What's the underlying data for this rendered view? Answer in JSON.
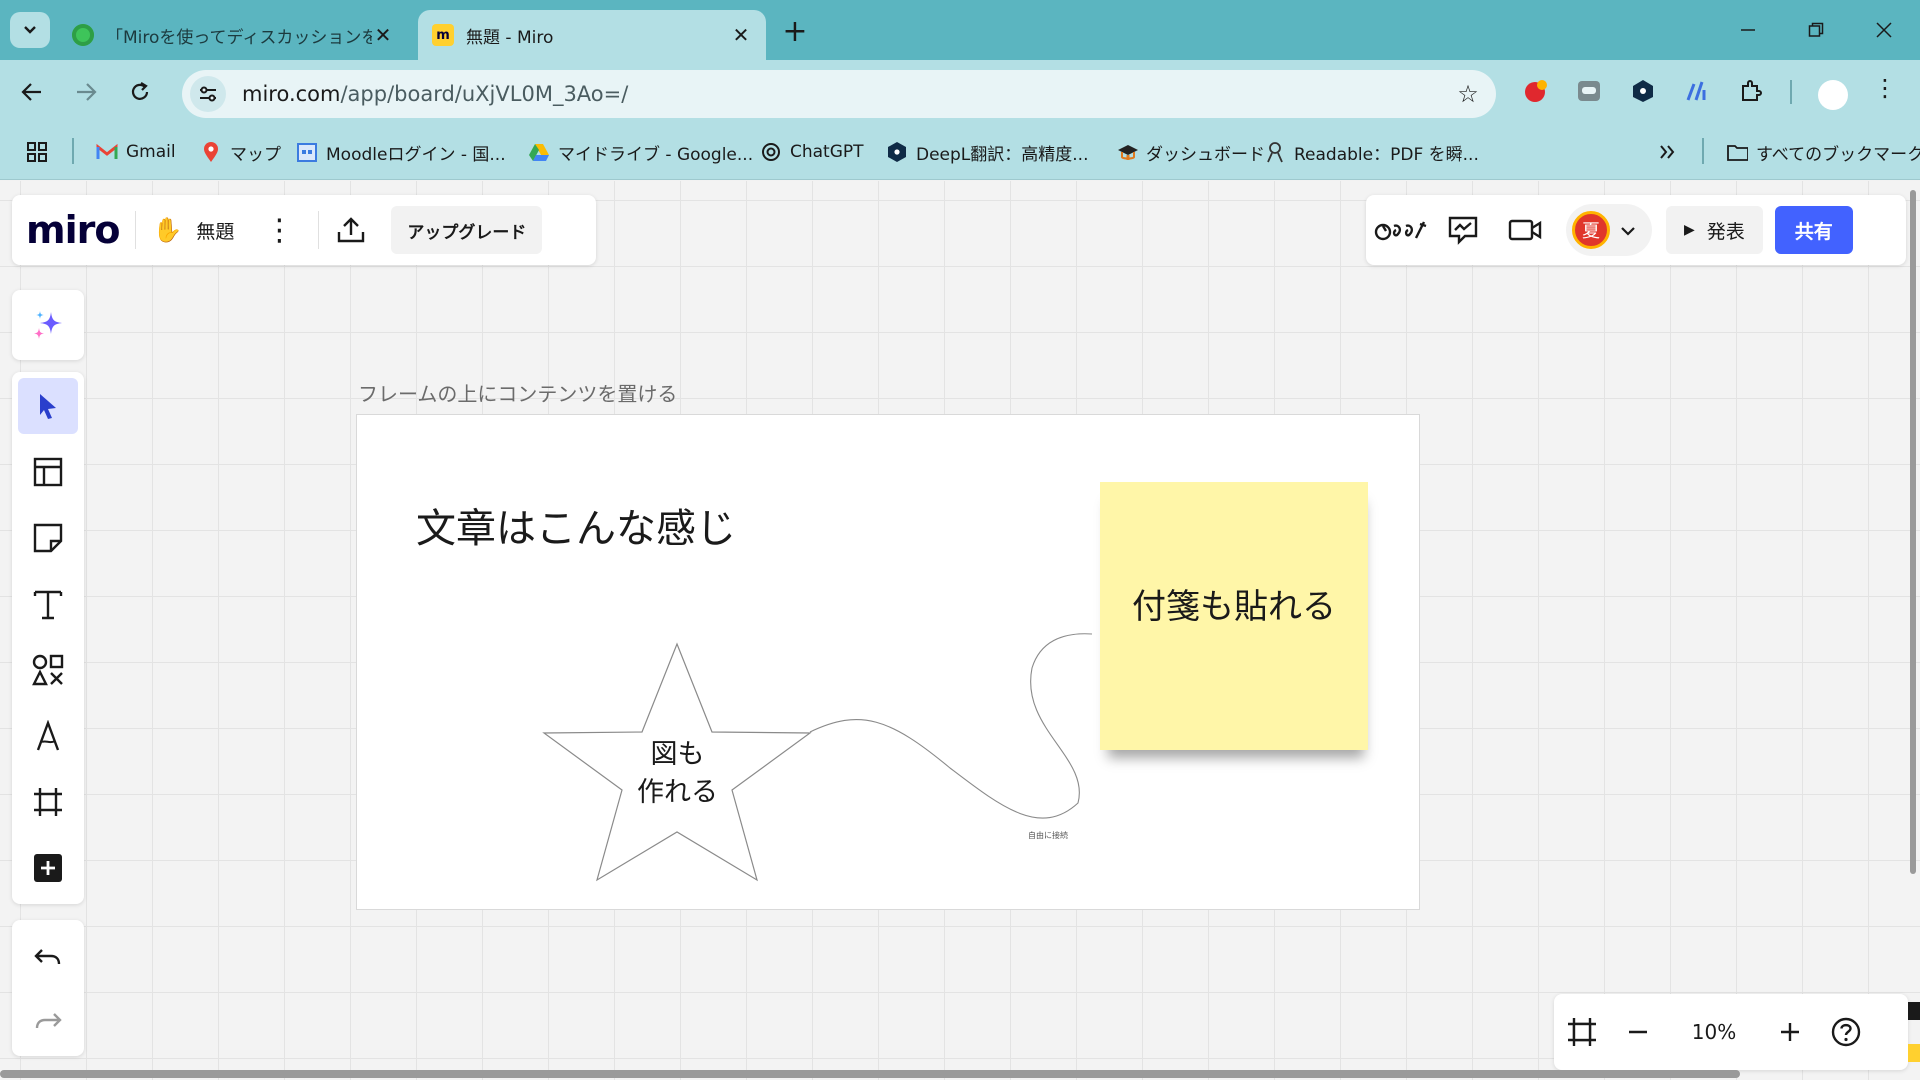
{
  "browser": {
    "tabs": [
      {
        "title": "「Miroを使ってディスカッションをオン",
        "favicon": "green-circle",
        "active": false
      },
      {
        "title": "無題 - Miro",
        "favicon": "miro",
        "active": true
      }
    ],
    "url_host": "miro.com",
    "url_path": "/app/board/uXjVL0M_3Ao=/",
    "bookmarks": [
      {
        "label": "Gmail",
        "icon": "gmail-icon"
      },
      {
        "label": "マップ",
        "icon": "maps-icon"
      },
      {
        "label": "Moodleログイン - 国...",
        "icon": "moodle-icon"
      },
      {
        "label": "マイドライブ - Google...",
        "icon": "drive-icon"
      },
      {
        "label": "ChatGPT",
        "icon": "chatgpt-icon"
      },
      {
        "label": "DeepL翻訳：高精度...",
        "icon": "deepl-icon"
      },
      {
        "label": "ダッシュボード",
        "icon": "dashboard-icon"
      },
      {
        "label": "Readable：PDF を瞬...",
        "icon": "readable-icon"
      }
    ],
    "all_bookmarks": "すべてのブックマーク",
    "colors": {
      "chrome": "#5bb5c0",
      "chrome_light": "#b3dfe4"
    }
  },
  "miro": {
    "logo": "miro",
    "board_name": "無題",
    "upgrade": "アップグレード",
    "avatar_initial": "夏",
    "present": "発表",
    "share": "共有",
    "zoom": "10%",
    "colors": {
      "accent": "#4262ff",
      "sticky": "#fff6a8",
      "tool_selected": "#dbe0ff"
    }
  },
  "canvas": {
    "frame_title": "フレームの上にコンテンツを置ける",
    "heading": "文章はこんな感じ",
    "sticky_note": "付箋も貼れる",
    "star_line1": "図も",
    "star_line2": "作れる",
    "connector_label": "自由に接続"
  }
}
